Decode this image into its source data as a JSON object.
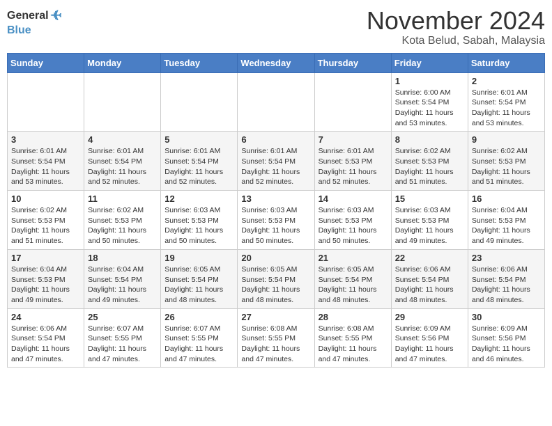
{
  "header": {
    "logo_general": "General",
    "logo_blue": "Blue",
    "month_title": "November 2024",
    "location": "Kota Belud, Sabah, Malaysia"
  },
  "calendar": {
    "days_of_week": [
      "Sunday",
      "Monday",
      "Tuesday",
      "Wednesday",
      "Thursday",
      "Friday",
      "Saturday"
    ],
    "weeks": [
      [
        {
          "day": null,
          "info": null
        },
        {
          "day": null,
          "info": null
        },
        {
          "day": null,
          "info": null
        },
        {
          "day": null,
          "info": null
        },
        {
          "day": null,
          "info": null
        },
        {
          "day": "1",
          "info": "Sunrise: 6:00 AM\nSunset: 5:54 PM\nDaylight: 11 hours\nand 53 minutes."
        },
        {
          "day": "2",
          "info": "Sunrise: 6:01 AM\nSunset: 5:54 PM\nDaylight: 11 hours\nand 53 minutes."
        }
      ],
      [
        {
          "day": "3",
          "info": "Sunrise: 6:01 AM\nSunset: 5:54 PM\nDaylight: 11 hours\nand 53 minutes."
        },
        {
          "day": "4",
          "info": "Sunrise: 6:01 AM\nSunset: 5:54 PM\nDaylight: 11 hours\nand 52 minutes."
        },
        {
          "day": "5",
          "info": "Sunrise: 6:01 AM\nSunset: 5:54 PM\nDaylight: 11 hours\nand 52 minutes."
        },
        {
          "day": "6",
          "info": "Sunrise: 6:01 AM\nSunset: 5:54 PM\nDaylight: 11 hours\nand 52 minutes."
        },
        {
          "day": "7",
          "info": "Sunrise: 6:01 AM\nSunset: 5:53 PM\nDaylight: 11 hours\nand 52 minutes."
        },
        {
          "day": "8",
          "info": "Sunrise: 6:02 AM\nSunset: 5:53 PM\nDaylight: 11 hours\nand 51 minutes."
        },
        {
          "day": "9",
          "info": "Sunrise: 6:02 AM\nSunset: 5:53 PM\nDaylight: 11 hours\nand 51 minutes."
        }
      ],
      [
        {
          "day": "10",
          "info": "Sunrise: 6:02 AM\nSunset: 5:53 PM\nDaylight: 11 hours\nand 51 minutes."
        },
        {
          "day": "11",
          "info": "Sunrise: 6:02 AM\nSunset: 5:53 PM\nDaylight: 11 hours\nand 50 minutes."
        },
        {
          "day": "12",
          "info": "Sunrise: 6:03 AM\nSunset: 5:53 PM\nDaylight: 11 hours\nand 50 minutes."
        },
        {
          "day": "13",
          "info": "Sunrise: 6:03 AM\nSunset: 5:53 PM\nDaylight: 11 hours\nand 50 minutes."
        },
        {
          "day": "14",
          "info": "Sunrise: 6:03 AM\nSunset: 5:53 PM\nDaylight: 11 hours\nand 50 minutes."
        },
        {
          "day": "15",
          "info": "Sunrise: 6:03 AM\nSunset: 5:53 PM\nDaylight: 11 hours\nand 49 minutes."
        },
        {
          "day": "16",
          "info": "Sunrise: 6:04 AM\nSunset: 5:53 PM\nDaylight: 11 hours\nand 49 minutes."
        }
      ],
      [
        {
          "day": "17",
          "info": "Sunrise: 6:04 AM\nSunset: 5:53 PM\nDaylight: 11 hours\nand 49 minutes."
        },
        {
          "day": "18",
          "info": "Sunrise: 6:04 AM\nSunset: 5:54 PM\nDaylight: 11 hours\nand 49 minutes."
        },
        {
          "day": "19",
          "info": "Sunrise: 6:05 AM\nSunset: 5:54 PM\nDaylight: 11 hours\nand 48 minutes."
        },
        {
          "day": "20",
          "info": "Sunrise: 6:05 AM\nSunset: 5:54 PM\nDaylight: 11 hours\nand 48 minutes."
        },
        {
          "day": "21",
          "info": "Sunrise: 6:05 AM\nSunset: 5:54 PM\nDaylight: 11 hours\nand 48 minutes."
        },
        {
          "day": "22",
          "info": "Sunrise: 6:06 AM\nSunset: 5:54 PM\nDaylight: 11 hours\nand 48 minutes."
        },
        {
          "day": "23",
          "info": "Sunrise: 6:06 AM\nSunset: 5:54 PM\nDaylight: 11 hours\nand 48 minutes."
        }
      ],
      [
        {
          "day": "24",
          "info": "Sunrise: 6:06 AM\nSunset: 5:54 PM\nDaylight: 11 hours\nand 47 minutes."
        },
        {
          "day": "25",
          "info": "Sunrise: 6:07 AM\nSunset: 5:55 PM\nDaylight: 11 hours\nand 47 minutes."
        },
        {
          "day": "26",
          "info": "Sunrise: 6:07 AM\nSunset: 5:55 PM\nDaylight: 11 hours\nand 47 minutes."
        },
        {
          "day": "27",
          "info": "Sunrise: 6:08 AM\nSunset: 5:55 PM\nDaylight: 11 hours\nand 47 minutes."
        },
        {
          "day": "28",
          "info": "Sunrise: 6:08 AM\nSunset: 5:55 PM\nDaylight: 11 hours\nand 47 minutes."
        },
        {
          "day": "29",
          "info": "Sunrise: 6:09 AM\nSunset: 5:56 PM\nDaylight: 11 hours\nand 47 minutes."
        },
        {
          "day": "30",
          "info": "Sunrise: 6:09 AM\nSunset: 5:56 PM\nDaylight: 11 hours\nand 46 minutes."
        }
      ]
    ]
  }
}
